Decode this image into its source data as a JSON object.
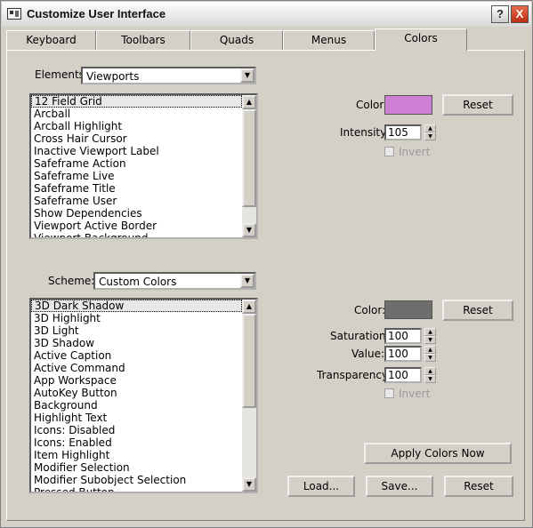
{
  "window": {
    "title": "Customize User Interface",
    "help_label": "?",
    "close_label": "X"
  },
  "tabs": [
    {
      "label": "Keyboard"
    },
    {
      "label": "Toolbars"
    },
    {
      "label": "Quads"
    },
    {
      "label": "Menus"
    },
    {
      "label": "Colors"
    }
  ],
  "elements": {
    "label": "Elements:",
    "selected": "Viewports",
    "items": [
      {
        "label": "12 Field Grid"
      },
      {
        "label": "Arcball"
      },
      {
        "label": "Arcball Highlight"
      },
      {
        "label": "Cross Hair Cursor"
      },
      {
        "label": "Inactive Viewport Label"
      },
      {
        "label": "Safeframe Action"
      },
      {
        "label": "Safeframe Live"
      },
      {
        "label": "Safeframe Title"
      },
      {
        "label": "Safeframe User"
      },
      {
        "label": "Show Dependencies"
      },
      {
        "label": "Viewport Active Border"
      },
      {
        "label": "Viewport Background"
      }
    ],
    "color_label": "Color:",
    "color_value": "#cc7fd3",
    "reset_label": "Reset",
    "intensity_label": "Intensity:",
    "intensity_value": "105",
    "invert_label": "Invert"
  },
  "scheme": {
    "label": "Scheme:",
    "selected": "Custom Colors",
    "items": [
      {
        "label": "3D Dark Shadow"
      },
      {
        "label": "3D Highlight"
      },
      {
        "label": "3D Light"
      },
      {
        "label": "3D Shadow"
      },
      {
        "label": "Active Caption"
      },
      {
        "label": "Active Command"
      },
      {
        "label": "App Workspace"
      },
      {
        "label": "AutoKey Button"
      },
      {
        "label": "Background"
      },
      {
        "label": "Highlight Text"
      },
      {
        "label": "Icons: Disabled"
      },
      {
        "label": "Icons: Enabled"
      },
      {
        "label": "Item Highlight"
      },
      {
        "label": "Modifier Selection"
      },
      {
        "label": "Modifier Subobject Selection"
      },
      {
        "label": "Pressed Button"
      }
    ],
    "color_label": "Color:",
    "color_value": "#6e6e6e",
    "reset_label": "Reset",
    "saturation_label": "Saturation:",
    "saturation_value": "100",
    "value_label": "Value:",
    "value_value": "100",
    "transparency_label": "Transparency:",
    "transparency_value": "100",
    "invert_label": "Invert"
  },
  "actions": {
    "apply_label": "Apply Colors Now",
    "load_label": "Load...",
    "save_label": "Save...",
    "reset_label": "Reset"
  }
}
